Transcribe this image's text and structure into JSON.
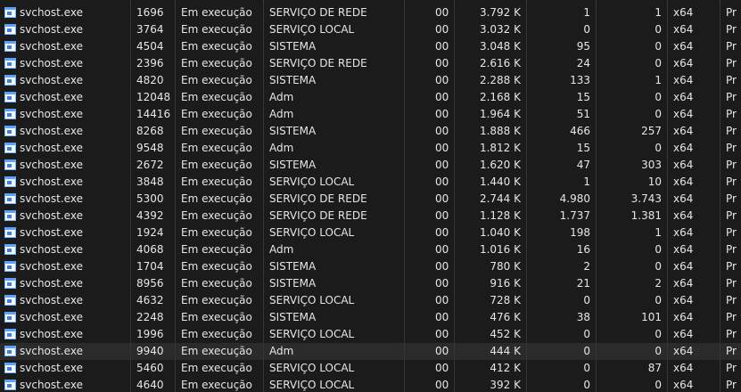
{
  "rows": [
    {
      "name": "svchost.exe",
      "pid": "1696",
      "status": "Em execução",
      "user": "SERVIÇO DE REDE",
      "cpu": "00",
      "mem": "3.792 K",
      "a": "1",
      "b": "1",
      "arch": "x64",
      "last": "Pr"
    },
    {
      "name": "svchost.exe",
      "pid": "3764",
      "status": "Em execução",
      "user": "SERVIÇO LOCAL",
      "cpu": "00",
      "mem": "3.032 K",
      "a": "0",
      "b": "0",
      "arch": "x64",
      "last": "Pr"
    },
    {
      "name": "svchost.exe",
      "pid": "4504",
      "status": "Em execução",
      "user": "SISTEMA",
      "cpu": "00",
      "mem": "3.048 K",
      "a": "95",
      "b": "0",
      "arch": "x64",
      "last": "Pr"
    },
    {
      "name": "svchost.exe",
      "pid": "2396",
      "status": "Em execução",
      "user": "SERVIÇO DE REDE",
      "cpu": "00",
      "mem": "2.616 K",
      "a": "24",
      "b": "0",
      "arch": "x64",
      "last": "Pr"
    },
    {
      "name": "svchost.exe",
      "pid": "4820",
      "status": "Em execução",
      "user": "SISTEMA",
      "cpu": "00",
      "mem": "2.288 K",
      "a": "133",
      "b": "1",
      "arch": "x64",
      "last": "Pr"
    },
    {
      "name": "svchost.exe",
      "pid": "12048",
      "status": "Em execução",
      "user": "Adm",
      "cpu": "00",
      "mem": "2.168 K",
      "a": "15",
      "b": "0",
      "arch": "x64",
      "last": "Pr"
    },
    {
      "name": "svchost.exe",
      "pid": "14416",
      "status": "Em execução",
      "user": "Adm",
      "cpu": "00",
      "mem": "1.964 K",
      "a": "51",
      "b": "0",
      "arch": "x64",
      "last": "Pr"
    },
    {
      "name": "svchost.exe",
      "pid": "8268",
      "status": "Em execução",
      "user": "SISTEMA",
      "cpu": "00",
      "mem": "1.888 K",
      "a": "466",
      "b": "257",
      "arch": "x64",
      "last": "Pr"
    },
    {
      "name": "svchost.exe",
      "pid": "9548",
      "status": "Em execução",
      "user": "Adm",
      "cpu": "00",
      "mem": "1.812 K",
      "a": "15",
      "b": "0",
      "arch": "x64",
      "last": "Pr"
    },
    {
      "name": "svchost.exe",
      "pid": "2672",
      "status": "Em execução",
      "user": "SISTEMA",
      "cpu": "00",
      "mem": "1.620 K",
      "a": "47",
      "b": "303",
      "arch": "x64",
      "last": "Pr"
    },
    {
      "name": "svchost.exe",
      "pid": "3848",
      "status": "Em execução",
      "user": "SERVIÇO LOCAL",
      "cpu": "00",
      "mem": "1.440 K",
      "a": "1",
      "b": "10",
      "arch": "x64",
      "last": "Pr"
    },
    {
      "name": "svchost.exe",
      "pid": "5300",
      "status": "Em execução",
      "user": "SERVIÇO DE REDE",
      "cpu": "00",
      "mem": "2.744 K",
      "a": "4.980",
      "b": "3.743",
      "arch": "x64",
      "last": "Pr"
    },
    {
      "name": "svchost.exe",
      "pid": "4392",
      "status": "Em execução",
      "user": "SERVIÇO DE REDE",
      "cpu": "00",
      "mem": "1.128 K",
      "a": "1.737",
      "b": "1.381",
      "arch": "x64",
      "last": "Pr"
    },
    {
      "name": "svchost.exe",
      "pid": "1924",
      "status": "Em execução",
      "user": "SERVIÇO LOCAL",
      "cpu": "00",
      "mem": "1.040 K",
      "a": "198",
      "b": "1",
      "arch": "x64",
      "last": "Pr"
    },
    {
      "name": "svchost.exe",
      "pid": "4068",
      "status": "Em execução",
      "user": "Adm",
      "cpu": "00",
      "mem": "1.016 K",
      "a": "16",
      "b": "0",
      "arch": "x64",
      "last": "Pr"
    },
    {
      "name": "svchost.exe",
      "pid": "1704",
      "status": "Em execução",
      "user": "SISTEMA",
      "cpu": "00",
      "mem": "780 K",
      "a": "2",
      "b": "0",
      "arch": "x64",
      "last": "Pr"
    },
    {
      "name": "svchost.exe",
      "pid": "8956",
      "status": "Em execução",
      "user": "SISTEMA",
      "cpu": "00",
      "mem": "916 K",
      "a": "21",
      "b": "2",
      "arch": "x64",
      "last": "Pr"
    },
    {
      "name": "svchost.exe",
      "pid": "4632",
      "status": "Em execução",
      "user": "SERVIÇO LOCAL",
      "cpu": "00",
      "mem": "728 K",
      "a": "0",
      "b": "0",
      "arch": "x64",
      "last": "Pr"
    },
    {
      "name": "svchost.exe",
      "pid": "2248",
      "status": "Em execução",
      "user": "SISTEMA",
      "cpu": "00",
      "mem": "476 K",
      "a": "38",
      "b": "101",
      "arch": "x64",
      "last": "Pr"
    },
    {
      "name": "svchost.exe",
      "pid": "1996",
      "status": "Em execução",
      "user": "SERVIÇO LOCAL",
      "cpu": "00",
      "mem": "452 K",
      "a": "0",
      "b": "0",
      "arch": "x64",
      "last": "Pr"
    },
    {
      "name": "svchost.exe",
      "pid": "9940",
      "status": "Em execução",
      "user": "Adm",
      "cpu": "00",
      "mem": "444 K",
      "a": "0",
      "b": "0",
      "arch": "x64",
      "last": "Pr",
      "highlighted": true
    },
    {
      "name": "svchost.exe",
      "pid": "5460",
      "status": "Em execução",
      "user": "SERVIÇO LOCAL",
      "cpu": "00",
      "mem": "412 K",
      "a": "0",
      "b": "87",
      "arch": "x64",
      "last": "Pr"
    },
    {
      "name": "svchost.exe",
      "pid": "4640",
      "status": "Em execução",
      "user": "SERVIÇO LOCAL",
      "cpu": "00",
      "mem": "392 K",
      "a": "0",
      "b": "0",
      "arch": "x64",
      "last": "Pr"
    }
  ],
  "icon": "app-window-icon",
  "colors": {
    "background": "#1b1b1b",
    "highlight": "#2b2b2b",
    "text": "#e6e6e6",
    "grid": "#353535",
    "icon": "#3d7fe0"
  }
}
